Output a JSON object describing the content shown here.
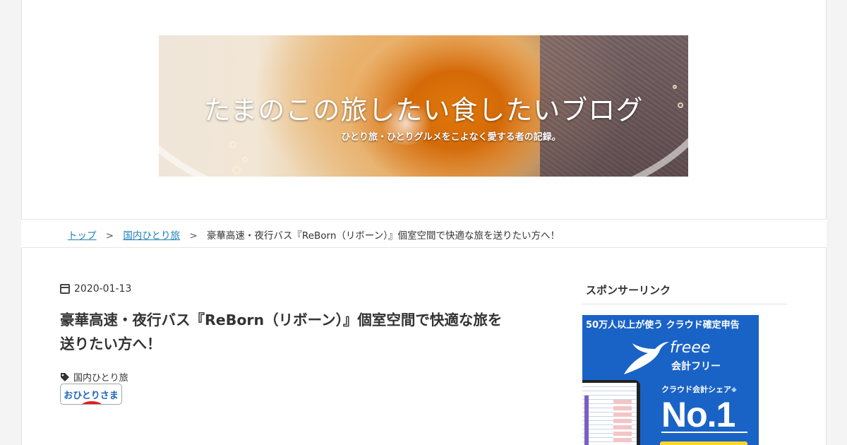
{
  "header": {
    "site_title": "たまのこの旅したい食したいブログ",
    "tagline": "ひとり旅・ひとりグルメをこよなく愛する者の記録。"
  },
  "breadcrumb": {
    "items": [
      {
        "label": "トップ"
      },
      {
        "label": "国内ひとり旅"
      }
    ],
    "separator": ">",
    "current": "豪華高速・夜行バス『ReBorn（リボーン）』個室空間で快適な旅を送りたい方へ！"
  },
  "article": {
    "date": "2020-01-13",
    "title": "豪華高速・夜行バス『ReBorn（リボーン）』個室空間で快適な旅を送りたい方へ！",
    "tag": "国内ひとり旅",
    "badge_label": "おひとりさま"
  },
  "sidebar": {
    "heading": "スポンサーリンク",
    "ad": {
      "top_text": "50万人以上が使う クラウド確定申告",
      "brand": "freee",
      "company": "会計フリー",
      "share_text": "クラウド会計シェア",
      "share_note": "※",
      "headline": "No.1"
    }
  },
  "colors": {
    "link": "#1f7fb6",
    "ad_background": "#1a63c6",
    "ad_cta": "#ffd629"
  }
}
